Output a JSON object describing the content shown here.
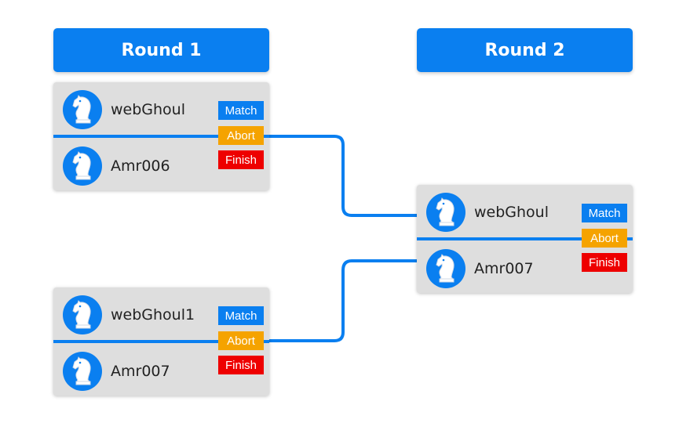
{
  "rounds": [
    {
      "title": "Round 1"
    },
    {
      "title": "Round 2"
    }
  ],
  "matches": [
    {
      "top_player": "webGhoul",
      "bottom_player": "Amr006",
      "buttons": {
        "match": "Match",
        "abort": "Abort",
        "finish": "Finish"
      }
    },
    {
      "top_player": "webGhoul1",
      "bottom_player": "Amr007",
      "buttons": {
        "match": "Match",
        "abort": "Abort",
        "finish": "Finish"
      }
    },
    {
      "top_player": "webGhoul",
      "bottom_player": "Amr007",
      "buttons": {
        "match": "Match",
        "abort": "Abort",
        "finish": "Finish"
      }
    }
  ],
  "colors": {
    "primary": "#0a7ff0",
    "abort": "#f5a300",
    "finish": "#ee0000",
    "card": "#dedede"
  },
  "icons": {
    "avatar": "chess-knight-icon"
  }
}
